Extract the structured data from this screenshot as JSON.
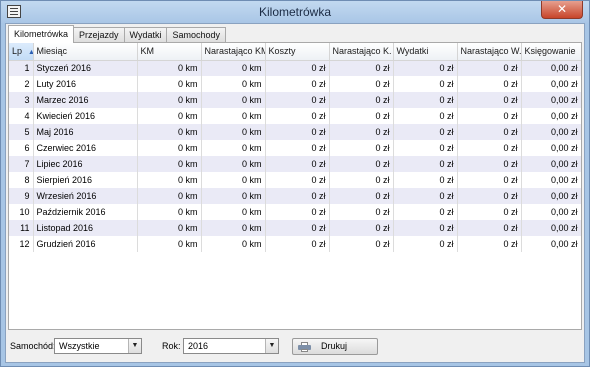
{
  "window": {
    "title": "Kilometrówka",
    "close_glyph": "✕",
    "icon": "app-icon"
  },
  "tabs": [
    {
      "label": "Kilometrówka",
      "active": true
    },
    {
      "label": "Przejazdy",
      "active": false
    },
    {
      "label": "Wydatki",
      "active": false
    },
    {
      "label": "Samochody",
      "active": false
    }
  ],
  "grid": {
    "columns": [
      "Lp",
      "Miesiąc",
      "KM",
      "Narastająco KM",
      "Koszty",
      "Narastająco K.",
      "Wydatki",
      "Narastająco W.",
      "Księgowanie"
    ],
    "sorted_column": "Lp",
    "sort_glyph": "▲",
    "rows": [
      [
        "1",
        "Styczeń 2016",
        "0 km",
        "0 km",
        "0 zł",
        "0 zł",
        "0 zł",
        "0 zł",
        "0,00 zł"
      ],
      [
        "2",
        "Luty 2016",
        "0 km",
        "0 km",
        "0 zł",
        "0 zł",
        "0 zł",
        "0 zł",
        "0,00 zł"
      ],
      [
        "3",
        "Marzec 2016",
        "0 km",
        "0 km",
        "0 zł",
        "0 zł",
        "0 zł",
        "0 zł",
        "0,00 zł"
      ],
      [
        "4",
        "Kwiecień 2016",
        "0 km",
        "0 km",
        "0 zł",
        "0 zł",
        "0 zł",
        "0 zł",
        "0,00 zł"
      ],
      [
        "5",
        "Maj 2016",
        "0 km",
        "0 km",
        "0 zł",
        "0 zł",
        "0 zł",
        "0 zł",
        "0,00 zł"
      ],
      [
        "6",
        "Czerwiec 2016",
        "0 km",
        "0 km",
        "0 zł",
        "0 zł",
        "0 zł",
        "0 zł",
        "0,00 zł"
      ],
      [
        "7",
        "Lipiec 2016",
        "0 km",
        "0 km",
        "0 zł",
        "0 zł",
        "0 zł",
        "0 zł",
        "0,00 zł"
      ],
      [
        "8",
        "Sierpień 2016",
        "0 km",
        "0 km",
        "0 zł",
        "0 zł",
        "0 zł",
        "0 zł",
        "0,00 zł"
      ],
      [
        "9",
        "Wrzesień 2016",
        "0 km",
        "0 km",
        "0 zł",
        "0 zł",
        "0 zł",
        "0 zł",
        "0,00 zł"
      ],
      [
        "10",
        "Październik 2016",
        "0 km",
        "0 km",
        "0 zł",
        "0 zł",
        "0 zł",
        "0 zł",
        "0,00 zł"
      ],
      [
        "11",
        "Listopad 2016",
        "0 km",
        "0 km",
        "0 zł",
        "0 zł",
        "0 zł",
        "0 zł",
        "0,00 zł"
      ],
      [
        "12",
        "Grudzień 2016",
        "0 km",
        "0 km",
        "0 zł",
        "0 zł",
        "0 zł",
        "0 zł",
        "0,00 zł"
      ]
    ]
  },
  "filters": {
    "car_label": "Samochód:",
    "car_value": "Wszystkie",
    "year_label": "Rok:",
    "year_value": "2016",
    "dropdown_glyph": "▼"
  },
  "actions": {
    "print_label": "Drukuj",
    "print_icon": "printer-icon"
  }
}
